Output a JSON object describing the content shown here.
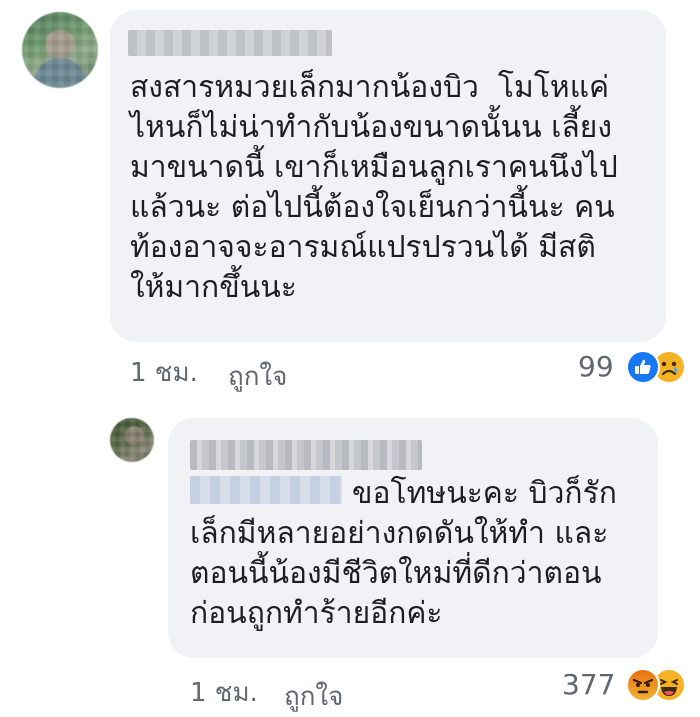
{
  "comments": [
    {
      "text_lines": [
        "สงสารหมวยเล็กมากน้องบิว  โมโหแค่",
        "ไหนก็ไม่น่าทำกับน้องขนาดนั้นน เลี้ยง",
        "มาขนาดนี้ เขาก็เหมือนลูกเราคนนึงไป",
        "แล้วนะ ต่อไปนี้ต้องใจเย็นกว่านี้นะ คน",
        "ท้องอาจจะอารมณ์แปรปรวนได้ มีสติ",
        "ให้มากขึ้นนะ"
      ],
      "text": "สงสารหมวยเล็กมากน้องบิว  โมโหแค่\nไหนก็ไม่น่าทำกับน้องขนาดนั้นน เลี้ยง\nมาขนาดนี้ เขาก็เหมือนลูกเราคนนึงไป\nแล้วนะ ต่อไปนี้ต้องใจเย็นกว่านี้นะ คน\nท้องอาจจะอารมณ์แปรปรวนได้ มีสติ\nให้มากขึ้นนะ",
      "time": "1 ชม.",
      "like_label": "ถูกใจ",
      "reaction_count": "99",
      "reactions": [
        "like-icon",
        "sad-icon"
      ]
    },
    {
      "text_first": "ขอโทษนะคะ บิวก็รัก",
      "text_rest": "เล็กมีหลายอย่างกดดันให้ทำ และ\nตอนนี้น้องมีชีวิตใหม่ที่ดีกว่าตอน\nก่อนถูกทำร้ายอีกค่ะ",
      "time": "1 ชม.",
      "like_label": "ถูกใจ",
      "reaction_count": "377",
      "reactions": [
        "angry-icon",
        "haha-icon"
      ]
    }
  ],
  "colors": {
    "bubble": "#f0f2f5",
    "text": "#1c1e21",
    "meta": "#606770",
    "like_blue": "#1877f2",
    "emoji_yellow": "#f7b125"
  }
}
